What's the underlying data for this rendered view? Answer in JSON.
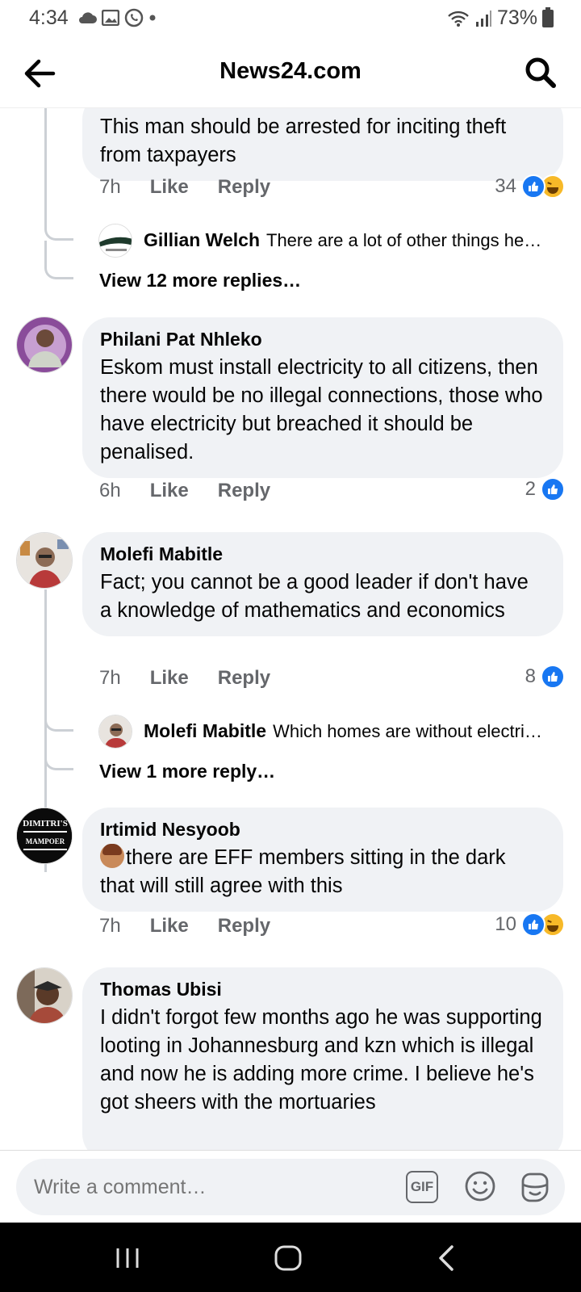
{
  "status_bar": {
    "time": "4:34",
    "battery": "73%"
  },
  "header": {
    "title": "News24.com"
  },
  "comments": {
    "c0": {
      "text": "This man should be arrested for inciting theft from taxpayers",
      "time": "7h",
      "like": "Like",
      "reply": "Reply",
      "reactions": "34",
      "reply_preview": {
        "author": "Gillian Welch",
        "text": "There are a lot of other things he…"
      },
      "view_more": "View 12 more replies…"
    },
    "c1": {
      "author": "Philani Pat Nhleko",
      "text": "Eskom must install electricity to all citizens, then there would be no illegal connections, those who have electricity but breached it should be penalised.",
      "time": "6h",
      "like": "Like",
      "reply": "Reply",
      "reactions": "2"
    },
    "c2": {
      "author": "Molefi Mabitle",
      "text": "Fact; you cannot be a good leader if don't have a knowledge of mathematics and economics",
      "time": "7h",
      "like": "Like",
      "reply": "Reply",
      "reactions": "8",
      "reply_preview": {
        "author": "Molefi Mabitle",
        "text": "Which homes are without electri…"
      },
      "view_more": "View 1 more reply…"
    },
    "c3": {
      "author": "Irtimid Nesyoob",
      "text": "there are EFF members sitting in the dark that will still agree with this",
      "time": "7h",
      "like": "Like",
      "reply": "Reply",
      "reactions": "10",
      "avatar_text": "MAMPOER"
    },
    "c4": {
      "author": "Thomas Ubisi",
      "text": "I didn't forgot few months ago he was supporting looting in Johannesburg and kzn which is illegal and now he is adding more crime. I believe he's got sheers with the mortuaries"
    }
  },
  "composer": {
    "placeholder": "Write a comment…",
    "gif_label": "GIF"
  },
  "colors": {
    "accent": "#1877f2",
    "bubble": "#f0f2f5",
    "muted": "#65676b"
  }
}
